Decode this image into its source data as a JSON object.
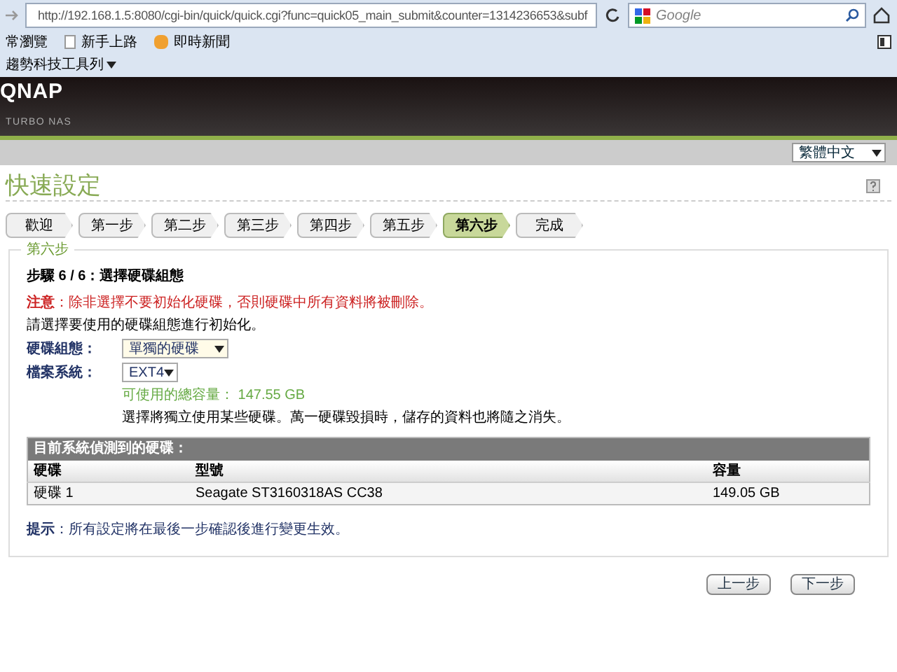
{
  "browser": {
    "url": "http://192.168.1.5:8080/cgi-bin/quick/quick.cgi?func=quick05_main_submit&counter=1314236653&subf",
    "search_placeholder": "Google",
    "bookmarks": [
      "常瀏覽",
      "新手上路",
      "即時新聞"
    ],
    "toolbar": "趨勢科技工具列"
  },
  "header": {
    "logo": "QNAP",
    "subtitle": "TURBO NAS"
  },
  "language": "繁體中文",
  "page_title": "快速設定",
  "steps": [
    {
      "label": "歡迎",
      "selected": false
    },
    {
      "label": "第一步",
      "selected": false
    },
    {
      "label": "第二步",
      "selected": false
    },
    {
      "label": "第三步",
      "selected": false
    },
    {
      "label": "第四步",
      "selected": false
    },
    {
      "label": "第五步",
      "selected": false
    },
    {
      "label": "第六步",
      "selected": true
    },
    {
      "label": "完成",
      "selected": false
    }
  ],
  "section": {
    "legend": "第六步",
    "heading": "步驟 6 / 6：選擇硬碟組態",
    "warning": "**注意**：除非選擇不要初始化硬碟，否則硬碟中所有資料將被刪除。",
    "instruction": "請選擇要使用的硬碟組態進行初始化。",
    "fields": [
      {
        "label": "硬碟組態：",
        "value": "單獨的硬碟",
        "kind": "wide"
      },
      {
        "label": "檔案系統：",
        "value": "EXT4",
        "kind": "narrow"
      }
    ],
    "capacity": "可使用的總容量： 147.55 GB",
    "note": "選擇將獨立使用某些硬碟。萬一硬碟毀損時，儲存的資料也將隨之消失。",
    "table": {
      "title": "目前系統偵測到的硬碟：",
      "columns": [
        "硬碟",
        "型號",
        "容量"
      ],
      "rows": [
        [
          "硬碟 1",
          "Seagate ST3160318AS CC38",
          "149.05 GB"
        ]
      ]
    },
    "tip": "**提示**：所有設定將在最後一步確認後進行變更生效。"
  },
  "buttons": [
    "上一步",
    "下一步"
  ]
}
